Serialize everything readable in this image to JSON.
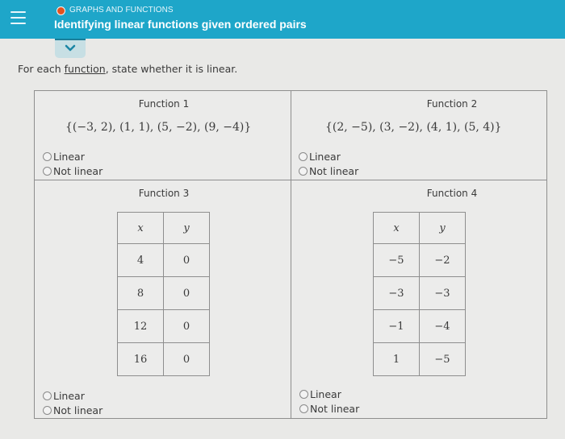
{
  "header": {
    "menu_icon": "hamburger-menu-icon",
    "topic_status_color": "#e3521f",
    "topic": "GRAPHS AND FUNCTIONS",
    "title": "Identifying linear functions given ordered pairs",
    "expand_icon": "chevron-down-icon",
    "accent_color": "#1ea6c9"
  },
  "instructions": {
    "before": "For each ",
    "link": "function",
    "after": ", state whether it is linear."
  },
  "functions": [
    {
      "title": "Function 1",
      "type": "set",
      "set": "{(−3, 2), (1, 1), (5, −2), (9, −4)}",
      "options": [
        "Linear",
        "Not linear"
      ],
      "selected": null
    },
    {
      "title": "Function 2",
      "type": "set",
      "set": "{(2, −5), (3, −2), (4, 1), (5, 4)}",
      "options": [
        "Linear",
        "Not linear"
      ],
      "selected": null
    },
    {
      "title": "Function 3",
      "type": "table",
      "headers": [
        "x",
        "y"
      ],
      "rows": [
        [
          "4",
          "0"
        ],
        [
          "8",
          "0"
        ],
        [
          "12",
          "0"
        ],
        [
          "16",
          "0"
        ]
      ],
      "options": [
        "Linear",
        "Not linear"
      ],
      "selected": null
    },
    {
      "title": "Function 4",
      "type": "table",
      "headers": [
        "x",
        "y"
      ],
      "rows": [
        [
          "−5",
          "−2"
        ],
        [
          "−3",
          "−3"
        ],
        [
          "−1",
          "−4"
        ],
        [
          "1",
          "−5"
        ]
      ],
      "options": [
        "Linear",
        "Not linear"
      ],
      "selected": null
    }
  ]
}
